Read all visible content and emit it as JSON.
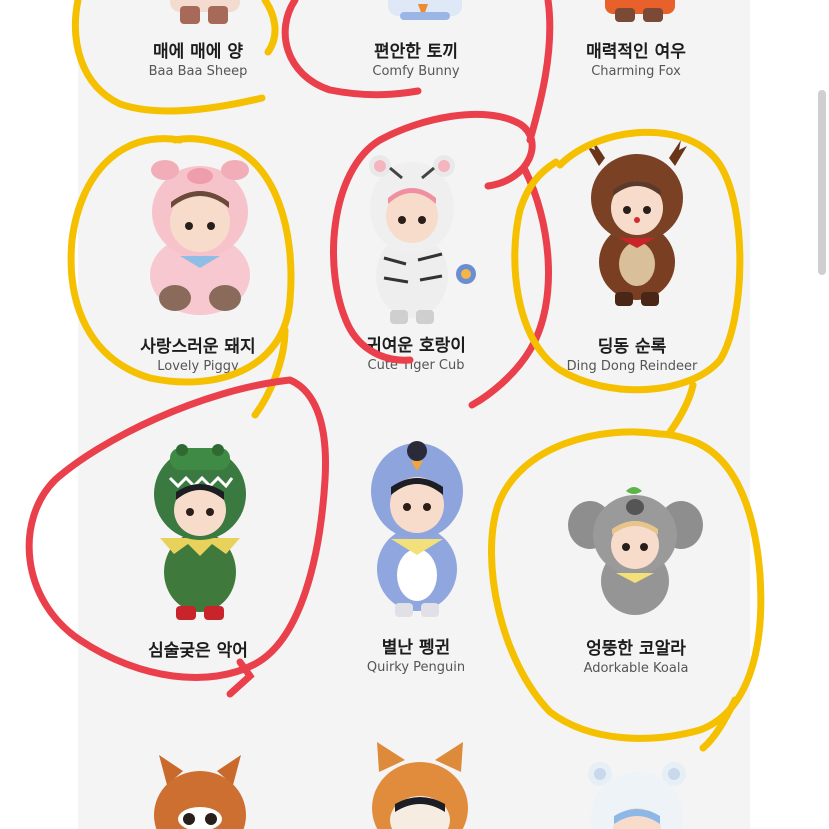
{
  "colors": {
    "panel_bg": "#f4f4f4",
    "yellow_marker": "#f5c000",
    "red_marker": "#e9404c"
  },
  "items": [
    {
      "kname": "매에 매에 양",
      "ename": "Baa Baa Sheep",
      "mark": "yellow-circle"
    },
    {
      "kname": "편안한 토끼",
      "ename": "Comfy Bunny",
      "mark": "red-circle"
    },
    {
      "kname": "매력적인 여우",
      "ename": "Charming  Fox",
      "mark": "none"
    },
    {
      "kname": "사랑스러운 돼지",
      "ename": "Lovely Piggy",
      "mark": "yellow-circle"
    },
    {
      "kname": "귀여운 호랑이",
      "ename": "Cute Tiger Cub",
      "mark": "red-circle"
    },
    {
      "kname": "딩동 순록",
      "ename": "Ding Dong Reindeer",
      "mark": "yellow-circle"
    },
    {
      "kname": "심술궂은 악어",
      "ename": "",
      "mark": "red-circle"
    },
    {
      "kname": "별난 펭귄",
      "ename": "Quirky Penguin",
      "mark": "none"
    },
    {
      "kname": "엉뚱한 코알라",
      "ename": "Adorkable Koala",
      "mark": "yellow-circle"
    }
  ]
}
